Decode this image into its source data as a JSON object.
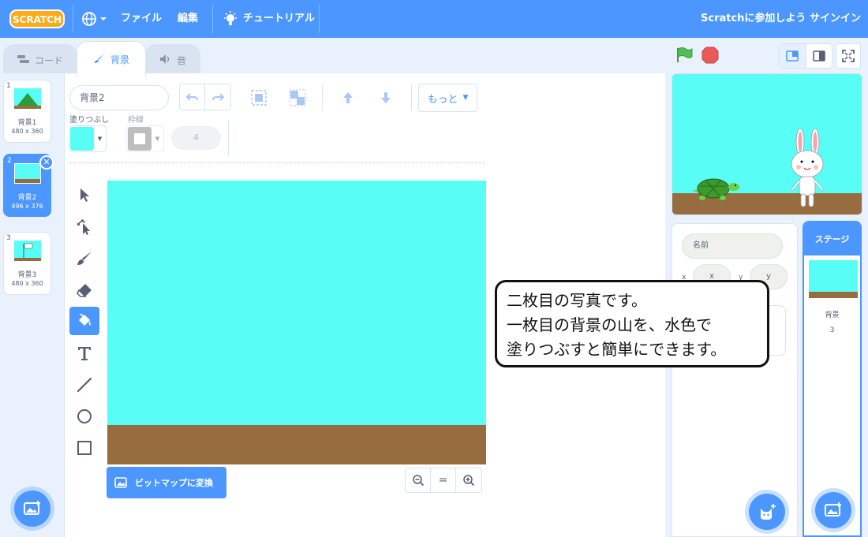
{
  "menubar": {
    "logo": "SCRATCH",
    "file": "ファイル",
    "edit": "編集",
    "tutorials": "チュートリアル",
    "join": "Scratchに参加しよう",
    "signin": "サインイン"
  },
  "tabs": {
    "code": "コード",
    "backdrops": "背景",
    "sounds": "音"
  },
  "costumes": [
    {
      "num": "1",
      "name": "背景1",
      "size": "480 x 360"
    },
    {
      "num": "2",
      "name": "背景2",
      "size": "496 x 376"
    },
    {
      "num": "3",
      "name": "背景3",
      "size": "480 x 360"
    }
  ],
  "editor": {
    "costume_name": "背景2",
    "more": "もっと",
    "fill_label": "塗りつぶし",
    "outline_label": "枠線",
    "outline_width": "4",
    "convert_bitmap": "ビットマップに変換",
    "zoom_reset": "=",
    "fill_color": "#58fdf6",
    "ground_color": "#976c3f"
  },
  "sprite_info": {
    "name_placeholder": "名前",
    "x_label": "x",
    "y_label": "y",
    "x_placeholder": "x",
    "y_placeholder": "y"
  },
  "stage_pane": {
    "title": "ステージ",
    "label": "背景",
    "count": "3"
  },
  "callout": {
    "line1": "二枚目の写真です。",
    "line2": "一枚目の背景の山を、水色で",
    "line3": "塗りつぶすと簡単にできます。"
  }
}
